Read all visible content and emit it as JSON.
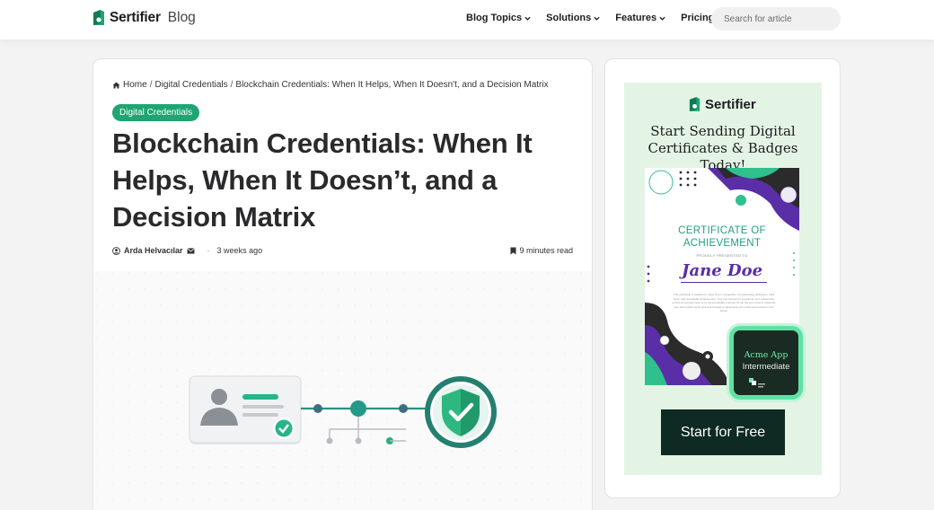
{
  "header": {
    "logo_brand": "Sertifier",
    "logo_suffix": "Blog",
    "nav": [
      {
        "label": "Blog Topics",
        "has_dropdown": true
      },
      {
        "label": "Solutions",
        "has_dropdown": true
      },
      {
        "label": "Features",
        "has_dropdown": true
      },
      {
        "label": "Pricing",
        "has_dropdown": false
      }
    ],
    "search_placeholder": "Search for article"
  },
  "article": {
    "breadcrumb": [
      "Home",
      "Digital Credentials",
      "Blockchain Credentials: When It Helps, When It Doesn't, and a Decision Matrix"
    ],
    "category": "Digital Credentials",
    "title": "Blockchain Credentials: When It Helps, When It Doesn’t, and a Decision Matrix",
    "author": "Arda Helvacılar",
    "published": "3 weeks ago",
    "read_time": "9 minutes read"
  },
  "ad": {
    "brand": "Sertifier",
    "headline_line1": "Start Sending Digital",
    "headline_line2": "Certificates & Badges Today!",
    "certificate_title_line1": "CERTIFICATE OF",
    "certificate_title_line2": "ACHIEVEMENT",
    "certificate_presented": "PROUDLY PRESENTED TO",
    "certificate_name": "Jane Doe",
    "certificate_body": "This certificate is awarded to Jane Doe in recognition of outstanding dedication, hard work, and remarkable achievement. Your commitment to excellence and unwavering pursuit of success have set a commendable example for all. We are proud to celebrate your accomplishments and look forward to witnessing your continued success in the future.",
    "badge_line1": "Acme App",
    "badge_line2": "Intermediate",
    "cta_label": "Start for Free"
  },
  "colors": {
    "accent_green": "#1ea672",
    "dark_green": "#0f2a22",
    "purple": "#5a2ea6"
  }
}
